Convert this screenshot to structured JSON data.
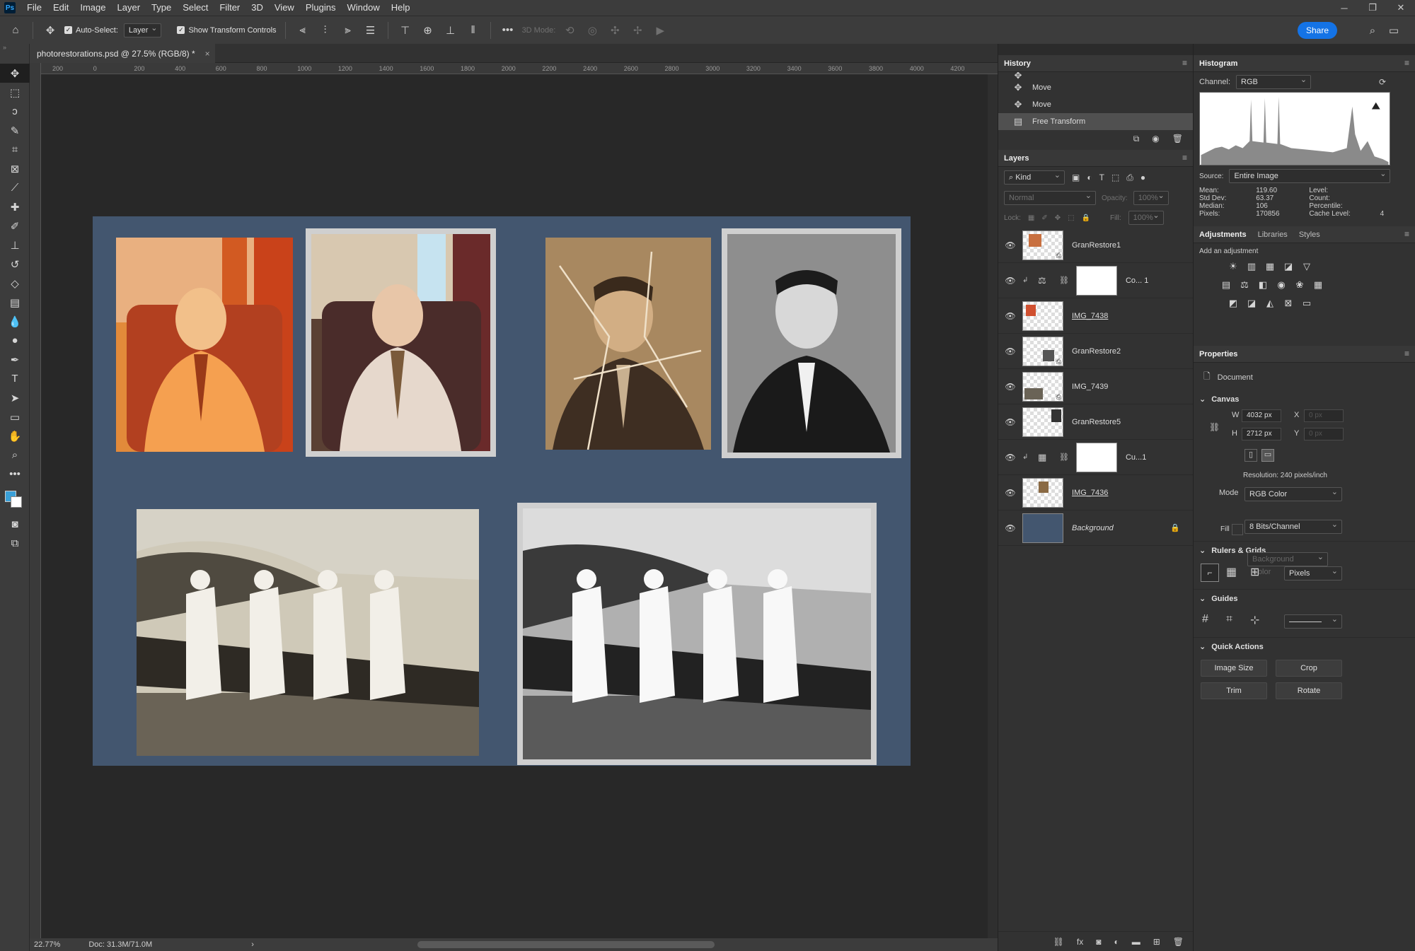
{
  "menu": [
    "File",
    "Edit",
    "Image",
    "Layer",
    "Type",
    "Select",
    "Filter",
    "3D",
    "View",
    "Plugins",
    "Window",
    "Help"
  ],
  "app_logo": "Ps",
  "window_controls": {
    "minimize": "─",
    "restore": "❐",
    "close": "✕"
  },
  "options": {
    "auto_select_label": "Auto-Select:",
    "auto_select_target": "Layer",
    "show_transform_label": "Show Transform Controls",
    "mode_3d_label": "3D Mode:",
    "share_label": "Share"
  },
  "document": {
    "tab_title": "photorestorations.psd @ 27.5% (RGB/8) *",
    "close_symbol": "×",
    "ruler_ticks": [
      "200",
      "0",
      "200",
      "400",
      "600",
      "800",
      "1000",
      "1200",
      "1400",
      "1600",
      "1800",
      "2000",
      "2200",
      "2400",
      "2600",
      "2800",
      "3000",
      "3200",
      "3400",
      "3600",
      "3800",
      "4000",
      "4200"
    ],
    "background_color": "#43566f"
  },
  "status": {
    "zoom": "22.77%",
    "doc": "Doc: 31.3M/71.0M",
    "arrow": "›"
  },
  "history": {
    "title": "History",
    "items": [
      "Move",
      "Move",
      "Move",
      "Free Transform"
    ],
    "selected_index": 3
  },
  "layers": {
    "title": "Layers",
    "filter_kind": "Kind",
    "blend_mode": "Normal",
    "opacity_label": "Opacity:",
    "opacity_value": "100%",
    "lock_label": "Lock:",
    "fill_label": "Fill:",
    "fill_value": "100%",
    "items": [
      {
        "name": "GranRestore1",
        "type": "smart",
        "style": ""
      },
      {
        "name": "Co... 1",
        "type": "adjust",
        "style": ""
      },
      {
        "name": "IMG_7438",
        "type": "smart",
        "style": "ul"
      },
      {
        "name": "GranRestore2",
        "type": "smart",
        "style": ""
      },
      {
        "name": "IMG_7439",
        "type": "smart",
        "style": ""
      },
      {
        "name": "GranRestore5",
        "type": "smart",
        "style": ""
      },
      {
        "name": "Cu...1",
        "type": "adjust",
        "style": ""
      },
      {
        "name": "IMG_7436",
        "type": "smart",
        "style": "ul"
      },
      {
        "name": "Background",
        "type": "bg",
        "style": "it"
      }
    ]
  },
  "histogram": {
    "title": "Histogram",
    "channel_label": "Channel:",
    "channel": "RGB",
    "source_label": "Source:",
    "source": "Entire Image",
    "stats": {
      "mean_label": "Mean:",
      "mean": "119.60",
      "stddev_label": "Std Dev:",
      "stddev": "63.37",
      "median_label": "Median:",
      "median": "106",
      "pixels_label": "Pixels:",
      "pixels": "170856",
      "level_label": "Level:",
      "count_label": "Count:",
      "percentile_label": "Percentile:",
      "cache_label": "Cache Level:",
      "cache": "4"
    }
  },
  "adjustments": {
    "tabs": [
      "Adjustments",
      "Libraries",
      "Styles"
    ],
    "add_label": "Add an adjustment"
  },
  "properties": {
    "title": "Properties",
    "doc_label": "Document",
    "canvas_label": "Canvas",
    "w_label": "W",
    "w_value": "4032 px",
    "h_label": "H",
    "h_value": "2712 px",
    "x_label": "X",
    "x_value": "0 px",
    "y_label": "Y",
    "y_value": "0 px",
    "resolution": "Resolution: 240 pixels/inch",
    "mode_label": "Mode",
    "mode_value": "RGB Color",
    "depth_value": "8 Bits/Channel",
    "fill_label": "Fill",
    "fill_value": "Background Color",
    "rulers_label": "Rulers & Grids",
    "units_value": "Pixels",
    "guides_label": "Guides",
    "quick_label": "Quick Actions",
    "quick_buttons": [
      "Image Size",
      "Crop",
      "Trim",
      "Rotate"
    ]
  }
}
